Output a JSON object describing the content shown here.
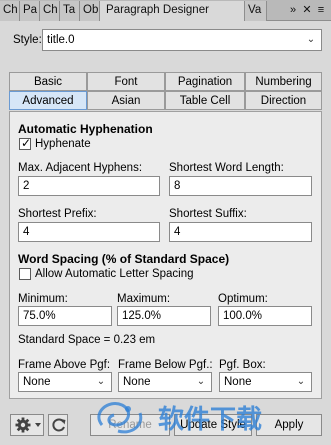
{
  "panel_tabs": [
    "Ch",
    "Pa",
    "Ch",
    "Ta",
    "Ob"
  ],
  "active_panel": "Paragraph Designer",
  "hidden_panel_tab": "Va",
  "panel_controls": {
    "overflow": "»",
    "close": "✕",
    "menu": "≡"
  },
  "style": {
    "label": "Style:",
    "value": "title.0"
  },
  "tabs": {
    "row1": [
      "Basic",
      "Font",
      "Pagination",
      "Numbering"
    ],
    "row2": [
      "Advanced",
      "Asian",
      "Table Cell",
      "Direction"
    ],
    "selected": "Advanced"
  },
  "hyphenation": {
    "heading": "Automatic Hyphenation",
    "hyphenate_label": "Hyphenate",
    "hyphenate_checked": true,
    "max_adjacent_label": "Max. Adjacent Hyphens:",
    "max_adjacent_value": "2",
    "shortest_word_label": "Shortest Word Length:",
    "shortest_word_value": "8",
    "shortest_prefix_label": "Shortest Prefix:",
    "shortest_prefix_value": "4",
    "shortest_suffix_label": "Shortest Suffix:",
    "shortest_suffix_value": "4"
  },
  "word_spacing": {
    "heading": "Word Spacing (% of Standard Space)",
    "letter_spacing_label": "Allow Automatic Letter Spacing",
    "letter_spacing_checked": false,
    "minimum_label": "Minimum:",
    "minimum_value": "75.0%",
    "maximum_label": "Maximum:",
    "maximum_value": "125.0%",
    "optimum_label": "Optimum:",
    "optimum_value": "100.0%",
    "standard_space": "Standard Space = 0.23 em"
  },
  "frames": {
    "above_label": "Frame Above Pgf:",
    "above_value": "None",
    "below_label": "Frame Below Pgf.:",
    "below_value": "None",
    "box_label": "Pgf. Box:",
    "box_value": "None"
  },
  "bottom": {
    "rename_label": "Rename",
    "update_label": "Update Style",
    "apply_label": "Apply"
  },
  "watermark_text": "软件下载"
}
